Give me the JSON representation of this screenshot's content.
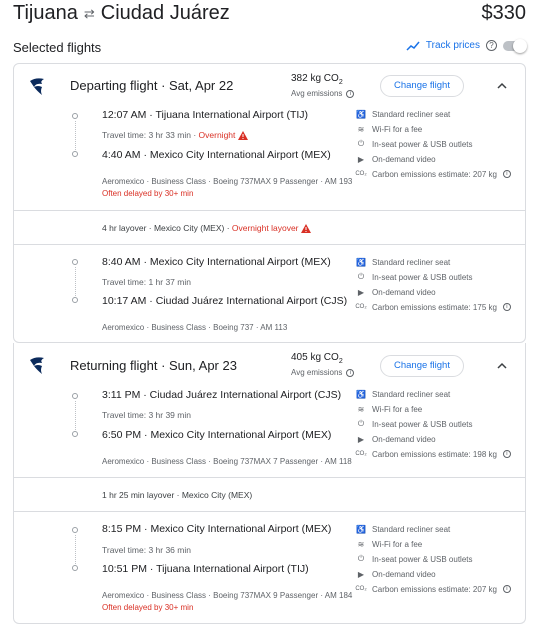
{
  "header": {
    "origin": "Tijuana",
    "destination": "Ciudad Juárez",
    "price": "$330"
  },
  "selected_label": "Selected flights",
  "track_prices": "Track prices",
  "change_label": "Change flight",
  "departing": {
    "title": "Departing flight",
    "date": "Sat, Apr 22",
    "co2": "382 kg CO",
    "co2_sub": "2",
    "emissions_label": "Avg emissions",
    "legs": [
      {
        "dep_time": "12:07 AM",
        "dep_airport": "Tijuana International Airport (TIJ)",
        "travel_time": "Travel time: 3 hr 33 min",
        "overnight": "Overnight",
        "arr_time": "4:40 AM",
        "arr_airport": "Mexico City International Airport (MEX)",
        "details": "Aeromexico · Business Class · Boeing 737MAX 9 Passenger · AM 193",
        "delayed": "Often delayed by 30+ min",
        "amenities": [
          "Standard recliner seat",
          "Wi-Fi for a fee",
          "In-seat power & USB outlets",
          "On-demand video",
          "Carbon emissions estimate: 207 kg"
        ]
      },
      {
        "dep_time": "8:40 AM",
        "dep_airport": "Mexico City International Airport (MEX)",
        "travel_time": "Travel time: 1 hr 37 min",
        "arr_time": "10:17 AM",
        "arr_airport": "Ciudad Juárez International Airport (CJS)",
        "details": "Aeromexico · Business Class · Boeing 737 · AM 113",
        "amenities": [
          "Standard recliner seat",
          "In-seat power & USB outlets",
          "On-demand video",
          "Carbon emissions estimate: 175 kg"
        ]
      }
    ],
    "layover": "4 hr layover · Mexico City (MEX) · ",
    "layover_overnight": "Overnight layover"
  },
  "returning": {
    "title": "Returning flight",
    "date": "Sun, Apr 23",
    "co2": "405 kg CO",
    "co2_sub": "2",
    "emissions_label": "Avg emissions",
    "legs": [
      {
        "dep_time": "3:11 PM",
        "dep_airport": "Ciudad Juárez International Airport (CJS)",
        "travel_time": "Travel time: 3 hr 39 min",
        "arr_time": "6:50 PM",
        "arr_airport": "Mexico City International Airport (MEX)",
        "details": "Aeromexico · Business Class · Boeing 737MAX 7 Passenger · AM 118",
        "amenities": [
          "Standard recliner seat",
          "Wi-Fi for a fee",
          "In-seat power & USB outlets",
          "On-demand video",
          "Carbon emissions estimate: 198 kg"
        ]
      },
      {
        "dep_time": "8:15 PM",
        "dep_airport": "Mexico City International Airport (MEX)",
        "travel_time": "Travel time: 3 hr 36 min",
        "arr_time": "10:51 PM",
        "arr_airport": "Tijuana International Airport (TIJ)",
        "details": "Aeromexico · Business Class · Boeing 737MAX 9 Passenger · AM 184",
        "delayed": "Often delayed by 30+ min",
        "amenities": [
          "Standard recliner seat",
          "Wi-Fi for a fee",
          "In-seat power & USB outlets",
          "On-demand video",
          "Carbon emissions estimate: 207 kg"
        ]
      }
    ],
    "layover": "1 hr 25 min layover · Mexico City (MEX)"
  },
  "colors": {
    "accent": "#1a73e8",
    "warning": "#d93025",
    "border": "#dadce0"
  },
  "icons": [
    "swap-arrow-icon",
    "trend-icon",
    "help-icon",
    "airline-logo-icon",
    "chevron-up-icon",
    "warning-icon",
    "seat-icon",
    "wifi-icon",
    "power-icon",
    "video-icon",
    "co2-icon",
    "info-icon"
  ]
}
